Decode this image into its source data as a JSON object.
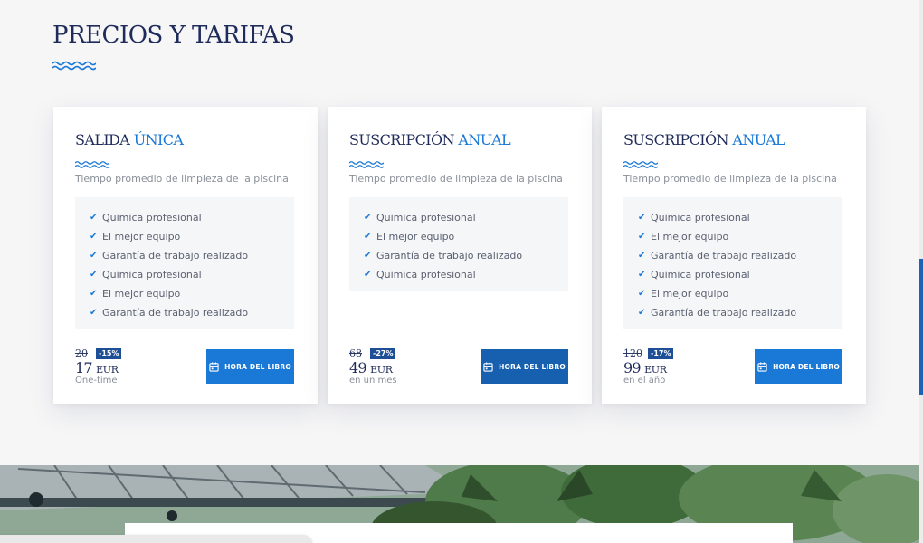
{
  "section": {
    "title": "PRECIOS Y TARIFAS"
  },
  "colors": {
    "navy": "#1f2b5a",
    "accent_blue": "#1a78d6",
    "badge_blue": "#1d4f97",
    "muted_text": "#8a8f99"
  },
  "cards": [
    {
      "title_part1": "SALIDA ",
      "title_part2": "ÚNICA",
      "subtitle": "Tiempo promedio de limpieza de la piscina",
      "features": [
        "Quimica profesional",
        "El mejor equipo",
        "Garantía de trabajo realizado",
        "Quimica profesional",
        "El mejor equipo",
        "Garantía de trabajo realizado"
      ],
      "old_price": "20",
      "discount": "-15%",
      "price": "17",
      "currency": "EUR",
      "period": "One-time",
      "button_label": "HORA DEL LIBRO"
    },
    {
      "title_part1": "SUSCRIPCIÓN ",
      "title_part2": "ANUAL",
      "subtitle": "Tiempo promedio de limpieza de la piscina",
      "features": [
        "Quimica profesional",
        "El mejor equipo",
        "Garantía de trabajo realizado",
        "Quimica profesional"
      ],
      "old_price": "68",
      "discount": "-27%",
      "price": "49",
      "currency": "EUR",
      "period": "en un mes",
      "button_label": "HORA DEL LIBRO"
    },
    {
      "title_part1": "SUSCRIPCIÓN ",
      "title_part2": "ANUAL",
      "subtitle": "Tiempo promedio de limpieza de la piscina",
      "features": [
        "Quimica profesional",
        "El mejor equipo",
        "Garantía de trabajo realizado",
        "Quimica profesional",
        "El mejor equipo",
        "Garantía de trabajo realizado"
      ],
      "old_price": "120",
      "discount": "-17%",
      "price": "99",
      "currency": "EUR",
      "period": "en el año",
      "button_label": "HORA DEL LIBRO"
    }
  ],
  "icons": {
    "check": "check-icon",
    "calendar": "calendar-icon",
    "waves": "waves-icon"
  }
}
